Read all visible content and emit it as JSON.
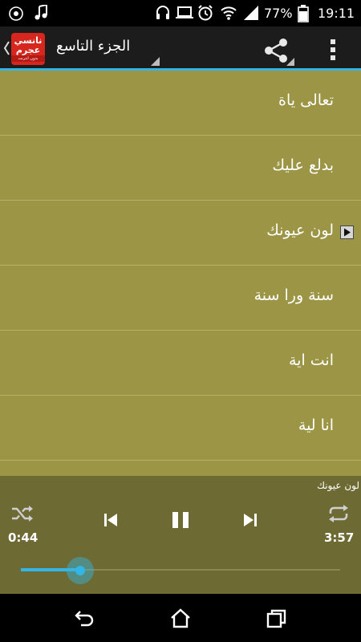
{
  "status_bar": {
    "battery_percent": "77%",
    "time": "19:11"
  },
  "action_bar": {
    "logo_line1": "نانسي",
    "logo_line2": "عجرم",
    "logo_line3": "بدون انترنت",
    "album_title": "الجزء التاسع"
  },
  "songs": [
    {
      "title": "تعالى ياة",
      "playing": false
    },
    {
      "title": "بدلع عليك",
      "playing": false
    },
    {
      "title": "لون عيونك",
      "playing": true
    },
    {
      "title": "سنة ورا سنة",
      "playing": false
    },
    {
      "title": "انت اية",
      "playing": false
    },
    {
      "title": "انا لية",
      "playing": false
    }
  ],
  "player": {
    "now_playing": "لون عيونك",
    "elapsed": "0:44",
    "duration": "3:57",
    "progress_fraction": 0.186
  },
  "colors": {
    "list_bg": "#9b9545",
    "player_bg": "#6d6a34",
    "accent": "#33b5e5",
    "logo_red": "#d7261e"
  }
}
